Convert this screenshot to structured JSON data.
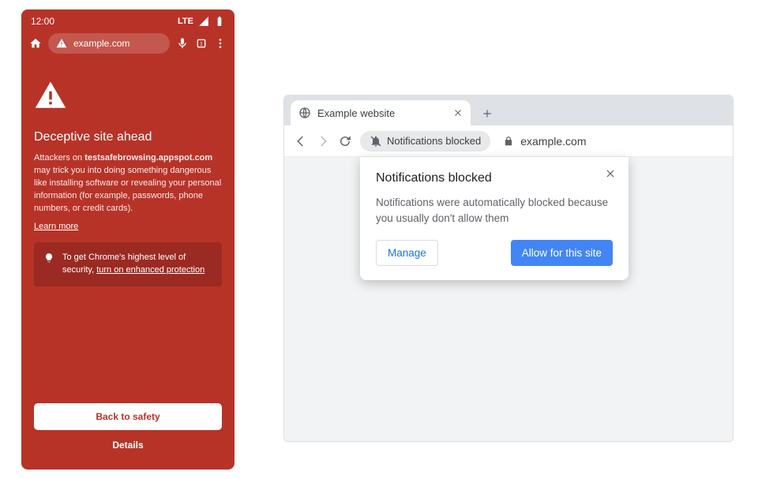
{
  "mobile": {
    "status": {
      "time": "12:00",
      "network": "LTE"
    },
    "omnibar": {
      "url": "example.com"
    },
    "warning": {
      "title": "Deceptive site ahead",
      "body_pre": "Attackers on ",
      "body_domain": "testsafebrowsing.appspot.com",
      "body_post": " may trick you into doing something dangerous like installing software or revealing your personal information (for example, passwords, phone numbers, or credit cards).",
      "learn_more": "Learn more"
    },
    "tip": {
      "text": "To get Chrome's highest level of security, ",
      "link": "turn on enhanced protection"
    },
    "actions": {
      "back": "Back to safety",
      "details": "Details"
    }
  },
  "desktop": {
    "tab": {
      "title": "Example website"
    },
    "chip": {
      "label": "Notifications blocked"
    },
    "address": {
      "url": "example.com"
    },
    "popup": {
      "title": "Notifications blocked",
      "body": "Notifications were automatically blocked because you usually don't allow them",
      "manage": "Manage",
      "allow": "Allow for this site"
    }
  }
}
